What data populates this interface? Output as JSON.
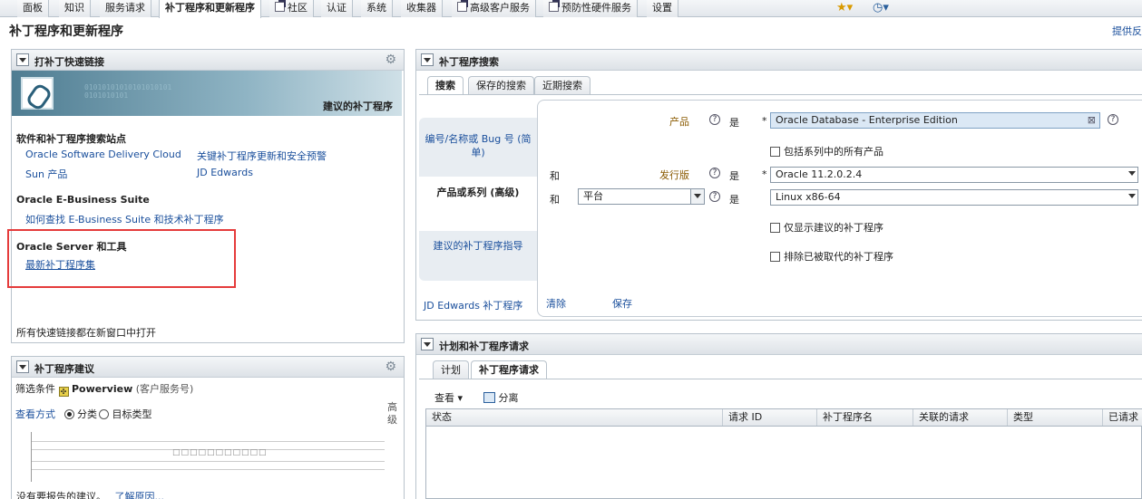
{
  "top_tabs": [
    "面板",
    "知识",
    "服务请求",
    "补丁程序和更新程序",
    "社区",
    "认证",
    "系统",
    "收集器",
    "高级客户服务",
    "预防性硬件服务",
    "设置"
  ],
  "page": {
    "title": "补丁程序和更新程序",
    "feedback": "提供反"
  },
  "quick_links": {
    "title": "打补丁快速链接",
    "banner_text": "建议的补丁程序",
    "sections": [
      {
        "heading": "软件和补丁程序搜索站点",
        "links": [
          "Oracle Software Delivery Cloud",
          "关键补丁程序更新和安全预警",
          "Sun 产品",
          "JD Edwards"
        ]
      },
      {
        "heading": "Oracle E-Business Suite",
        "links": [
          "如何查找 E-Business Suite 和技术补丁程序"
        ]
      },
      {
        "heading": "Oracle Server 和工具",
        "links": [
          "最新补丁程序集"
        ]
      }
    ],
    "footer": "所有快速链接都在新窗口中打开"
  },
  "recommendations": {
    "title": "补丁程序建议",
    "filter_label": "筛选条件",
    "filter_value": "Powerview",
    "filter_suffix": "(客户服务号)",
    "view_label": "查看方式",
    "radio_category": "分类",
    "radio_target": "目标类型",
    "side_label": "高\n级",
    "chart_placeholder": "□□□□□□□□□□□",
    "empty_text": "没有要报告的建议。",
    "learn_more": "了解原因..."
  },
  "search": {
    "title": "补丁程序搜索",
    "tabs": [
      "搜索",
      "保存的搜索",
      "近期搜索"
    ],
    "side_tabs": [
      "编号/名称或 Bug 号 (简单)",
      "产品或系列 (高级)",
      "建议的补丁程序指导",
      "JD Edwards 补丁程序"
    ],
    "product_label": "产品",
    "is_label": "是",
    "product_value": "Oracle Database - Enterprise Edition",
    "include_family": "包括系列中的所有产品",
    "and_label": "和",
    "release_label": "发行版",
    "release_value": "Oracle 11.2.0.2.4",
    "platform_select": "平台",
    "platform_value": "Linux x86-64",
    "only_recommended": "仅显示建议的补丁程序",
    "exclude_superseded": "排除已被取代的补丁程序",
    "clear_label": "清除",
    "save_label": "保存"
  },
  "plans": {
    "title": "计划和补丁程序请求",
    "tabs": [
      "计划",
      "补丁程序请求"
    ],
    "view_menu": "查看",
    "detach": "分离",
    "columns": [
      "状态",
      "请求 ID",
      "补丁程序名",
      "关联的请求",
      "类型",
      "已请求"
    ]
  }
}
